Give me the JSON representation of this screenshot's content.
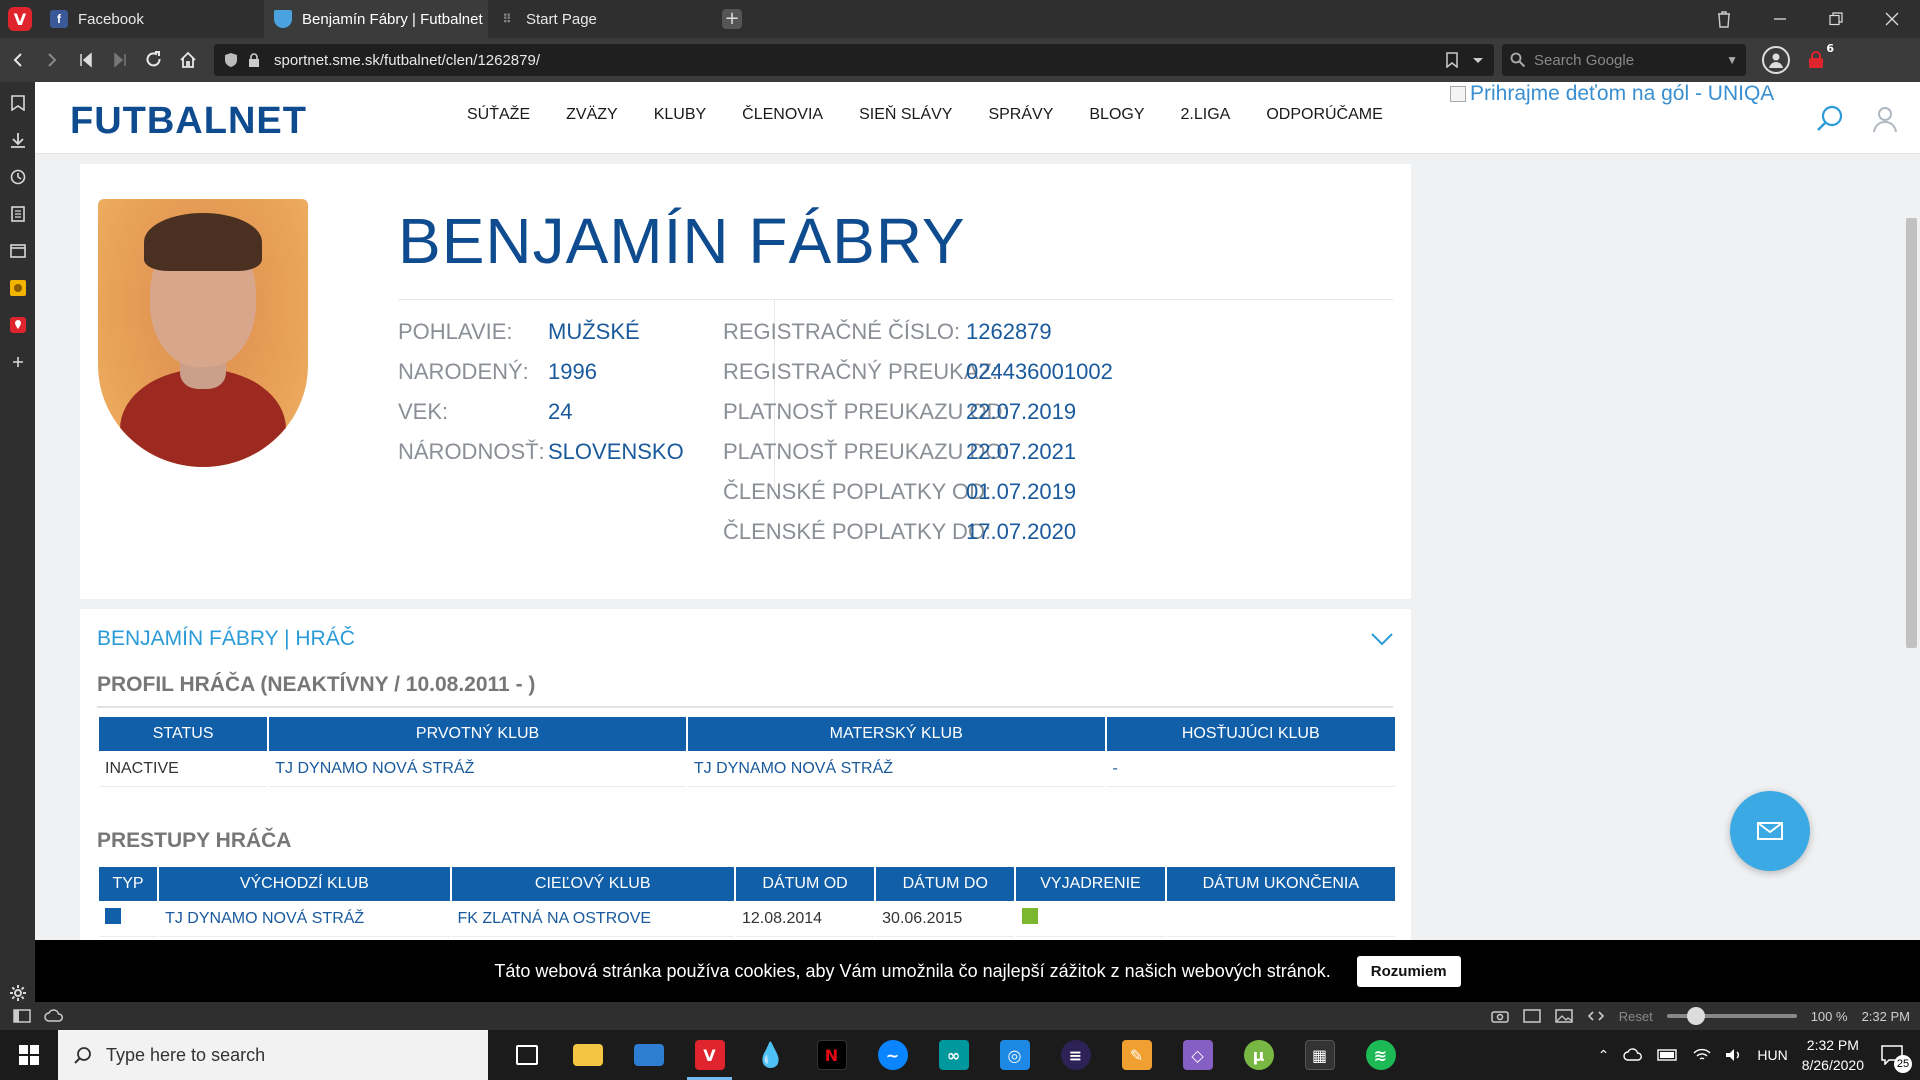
{
  "browser": {
    "tabs": [
      {
        "label": "Facebook",
        "icon": "facebook-icon",
        "active": false
      },
      {
        "label": "Benjamín Fábry | Futbalnet",
        "icon": "futbalnet-favicon",
        "active": true
      },
      {
        "label": "Start Page",
        "icon": "start-page-icon",
        "active": false
      }
    ],
    "url": "sportnet.sme.sk/futbalnet/clen/1262879/",
    "search_placeholder": "Search Google",
    "extension_badge": "6"
  },
  "site": {
    "logo": "FUTBALNET",
    "nav": [
      "SÚŤAŽE",
      "ZVÄZY",
      "KLUBY",
      "ČLENOVIA",
      "SIEŇ SLÁVY",
      "SPRÁVY",
      "BLOGY",
      "2.LIGA",
      "ODPORÚČAME"
    ],
    "sponsor_alt": "Prihrajme deťom na gól - UNIQA"
  },
  "player": {
    "name": "BENJAMÍN FÁBRY",
    "left_fields": [
      {
        "label": "POHLAVIE:",
        "value": "MUŽSKÉ"
      },
      {
        "label": "NARODENÝ:",
        "value": "1996"
      },
      {
        "label": "VEK:",
        "value": "24"
      },
      {
        "label": "NÁRODNOSŤ:",
        "value": "SLOVENSKO"
      }
    ],
    "right_fields": [
      {
        "label": "REGISTRAČNÉ ČÍSLO:",
        "value": "1262879"
      },
      {
        "label": "REGISTRAČNÝ PREUKAZ:",
        "value": "024436001002"
      },
      {
        "label": "PLATNOSŤ PREUKAZU OD:",
        "value": "22.07.2019"
      },
      {
        "label": "PLATNOSŤ PREUKAZU DO:",
        "value": "22.07.2021"
      },
      {
        "label": "ČLENSKÉ POPLATKY OD:",
        "value": "01.07.2019"
      },
      {
        "label": "ČLENSKÉ POPLATKY DO:",
        "value": "17.07.2020"
      }
    ]
  },
  "player_section": {
    "heading": "BENJAMÍN FÁBRY | HRÁČ",
    "profile_title": "PROFIL HRÁČA (NEAKTÍVNY / 10.08.2011 - )",
    "profile_table": {
      "headers": [
        "STATUS",
        "PRVOTNÝ KLUB",
        "MATERSKÝ KLUB",
        "HOSŤUJÚCI KLUB"
      ],
      "row": [
        "INACTIVE",
        "TJ DYNAMO NOVÁ STRÁŽ",
        "TJ DYNAMO NOVÁ STRÁŽ",
        "-"
      ]
    },
    "transfers_title": "PRESTUPY HRÁČA",
    "transfers_table": {
      "headers": [
        "TYP",
        "VÝCHODZÍ KLUB",
        "CIEĽOVÝ KLUB",
        "DÁTUM OD",
        "DÁTUM DO",
        "VYJADRENIE",
        "DÁTUM UKONČENIA"
      ],
      "row": [
        "",
        "TJ DYNAMO NOVÁ STRÁŽ",
        "FK ZLATNÁ NA OSTROVE",
        "12.08.2014",
        "30.06.2015",
        "",
        ""
      ]
    }
  },
  "cookie_bar": {
    "message": "Táto webová stránka používa cookies, aby Vám umožnila čo najlepší zážitok z našich webových stránok.",
    "button": "Rozumiem"
  },
  "statusbar": {
    "reset": "Reset",
    "zoom": "100 %",
    "time": "2:32 PM"
  },
  "taskbar": {
    "search_placeholder": "Type here to search",
    "language": "HUN",
    "clock_time": "2:32 PM",
    "clock_date": "8/26/2020",
    "notifications": "25"
  },
  "colors": {
    "brand_blue": "#0f4c8f",
    "accent_blue": "#2b9bd8",
    "table_header": "#115fa8",
    "vivaldi_red": "#e0242d"
  }
}
